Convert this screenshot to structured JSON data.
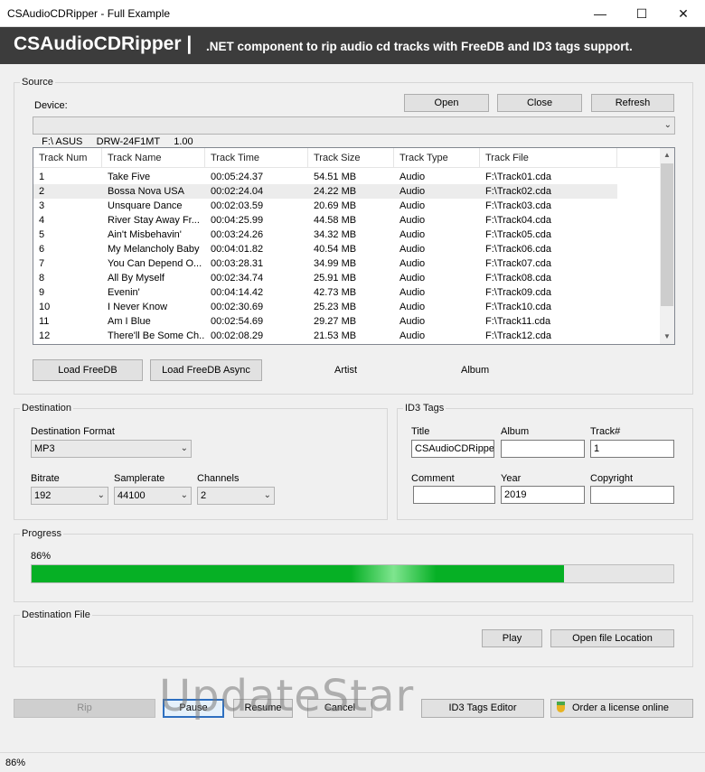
{
  "window": {
    "title": "CSAudioCDRipper - Full Example",
    "minimize": "—",
    "maximize": "☐",
    "close": "✕"
  },
  "banner": {
    "brand": "CSAudioCDRipper |",
    "tagline": ".NET component to rip audio cd tracks with FreeDB and ID3 tags support."
  },
  "source": {
    "label": "Source",
    "device_label": "Device:",
    "open": "Open",
    "close": "Close",
    "refresh": "Refresh",
    "device_value": "F:\\ ASUS     DRW-24F1MT     1.00",
    "columns": [
      "Track Num",
      "Track Name",
      "Track Time",
      "Track Size",
      "Track Type",
      "Track File"
    ],
    "tracks": [
      [
        "1",
        "Take Five",
        "00:05:24.37",
        "54.51 MB",
        "Audio",
        "F:\\Track01.cda"
      ],
      [
        "2",
        "Bossa Nova USA",
        "00:02:24.04",
        "24.22 MB",
        "Audio",
        "F:\\Track02.cda"
      ],
      [
        "3",
        "Unsquare Dance",
        "00:02:03.59",
        "20.69 MB",
        "Audio",
        "F:\\Track03.cda"
      ],
      [
        "4",
        "River Stay Away Fr...",
        "00:04:25.99",
        "44.58 MB",
        "Audio",
        "F:\\Track04.cda"
      ],
      [
        "5",
        "Ain't Misbehavin'",
        "00:03:24.26",
        "34.32 MB",
        "Audio",
        "F:\\Track05.cda"
      ],
      [
        "6",
        "My Melancholy Baby",
        "00:04:01.82",
        "40.54 MB",
        "Audio",
        "F:\\Track06.cda"
      ],
      [
        "7",
        "You Can Depend O...",
        "00:03:28.31",
        "34.99 MB",
        "Audio",
        "F:\\Track07.cda"
      ],
      [
        "8",
        "All By Myself",
        "00:02:34.74",
        "25.91 MB",
        "Audio",
        "F:\\Track08.cda"
      ],
      [
        "9",
        "Evenin'",
        "00:04:14.42",
        "42.73 MB",
        "Audio",
        "F:\\Track09.cda"
      ],
      [
        "10",
        "I Never Know",
        "00:02:30.69",
        "25.23 MB",
        "Audio",
        "F:\\Track10.cda"
      ],
      [
        "11",
        "Am I Blue",
        "00:02:54.69",
        "29.27 MB",
        "Audio",
        "F:\\Track11.cda"
      ],
      [
        "12",
        "There'll Be Some Ch...",
        "00:02:08.29",
        "21.53 MB",
        "Audio",
        "F:\\Track12.cda"
      ]
    ],
    "selected_row": 1,
    "load_freedb": "Load FreeDB",
    "load_freedb_async": "Load FreeDB Async",
    "artist": "Artist",
    "album": "Album"
  },
  "destination": {
    "label": "Destination",
    "format_label": "Destination Format",
    "format_value": "MP3",
    "bitrate_label": "Bitrate",
    "bitrate_value": "192",
    "samplerate_label": "Samplerate",
    "samplerate_value": "44100",
    "channels_label": "Channels",
    "channels_value": "2"
  },
  "id3": {
    "label": "ID3 Tags",
    "title_label": "Title",
    "title_value": "CSAudioCDRipper",
    "album_label": "Album",
    "album_value": "",
    "track_label": "Track#",
    "track_value": "1",
    "comment_label": "Comment",
    "comment_value": "",
    "year_label": "Year",
    "year_value": "2019",
    "copyright_label": "Copyright",
    "copyright_value": ""
  },
  "progress": {
    "label": "Progress",
    "percent_text": "86%",
    "value": 0.83
  },
  "destination_file": {
    "label": "Destination File",
    "play": "Play",
    "open_location": "Open file Location"
  },
  "actions": {
    "rip": "Rip",
    "pause": "Pause",
    "resume": "Resume",
    "cancel": "Cancel",
    "id3_editor": "ID3 Tags Editor",
    "order": "Order a license online"
  },
  "watermark": "UpdateStar",
  "status": {
    "text": "86%"
  },
  "colors": {
    "banner": "#3c3c3c",
    "progress": "#06b025",
    "focus": "#2d6fc0"
  }
}
